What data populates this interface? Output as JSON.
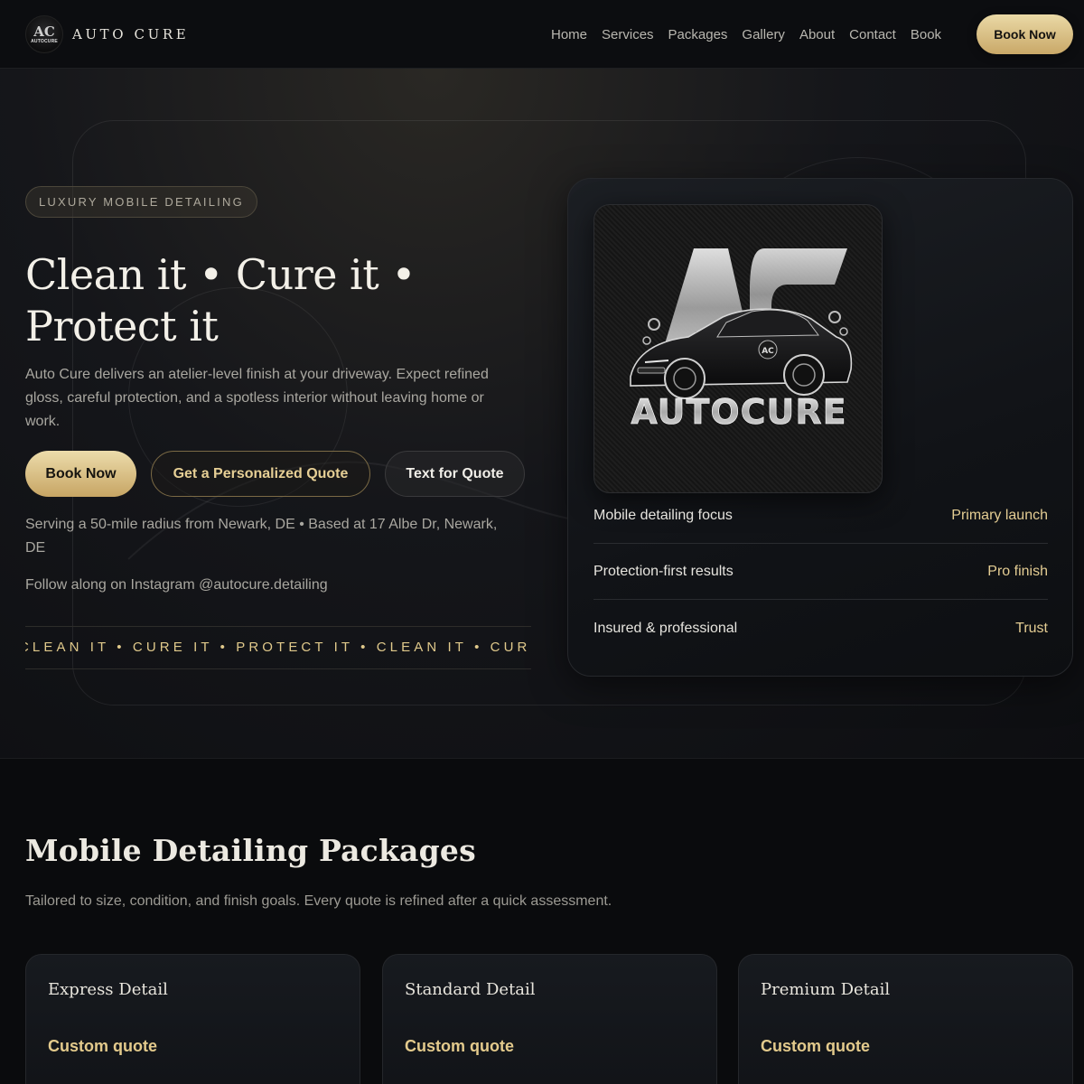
{
  "brand": {
    "name": "AUTO CURE",
    "logo_text": "AC",
    "logo_sub": "AUTOCURE"
  },
  "nav": {
    "links": [
      "Home",
      "Services",
      "Packages",
      "Gallery",
      "About",
      "Contact",
      "Book"
    ],
    "cta": "Book Now"
  },
  "hero": {
    "badge": "LUXURY MOBILE DETAILING",
    "title": "Clean it • Cure it • Protect it",
    "description": "Auto Cure delivers an atelier-level finish at your driveway. Expect refined gloss, careful protection, and a spotless interior without leaving home or work.",
    "buttons": {
      "book": "Book Now",
      "quote": "Get a Personalized Quote",
      "text": "Text for Quote"
    },
    "service_area": "Serving a 50-mile radius from Newark, DE • Based at 17 Albe Dr, Newark, DE",
    "instagram": "Follow along on Instagram @autocure.detailing",
    "marquee": "CLEAN IT • CURE IT • PROTECT IT • CLEAN IT • CURE IT • PROTECT IT"
  },
  "info_card": {
    "logo_wordmark": "AUTOCURE",
    "logo_monogram": "AC",
    "rows": [
      {
        "label": "Mobile detailing focus",
        "value": "Primary launch"
      },
      {
        "label": "Protection-first results",
        "value": "Pro finish"
      },
      {
        "label": "Insured & professional",
        "value": "Trust"
      }
    ]
  },
  "packages": {
    "title": "Mobile Detailing Packages",
    "subtitle": "Tailored to size, condition, and finish goals. Every quote is refined after a quick assessment.",
    "items": [
      {
        "name": "Express Detail",
        "price": "Custom quote"
      },
      {
        "name": "Standard Detail",
        "price": "Custom quote"
      },
      {
        "name": "Premium Detail",
        "price": "Custom quote"
      }
    ]
  },
  "colors": {
    "gold": "#e4cd93",
    "gold_button": "#c9a868",
    "background": "#0a0b0d"
  }
}
